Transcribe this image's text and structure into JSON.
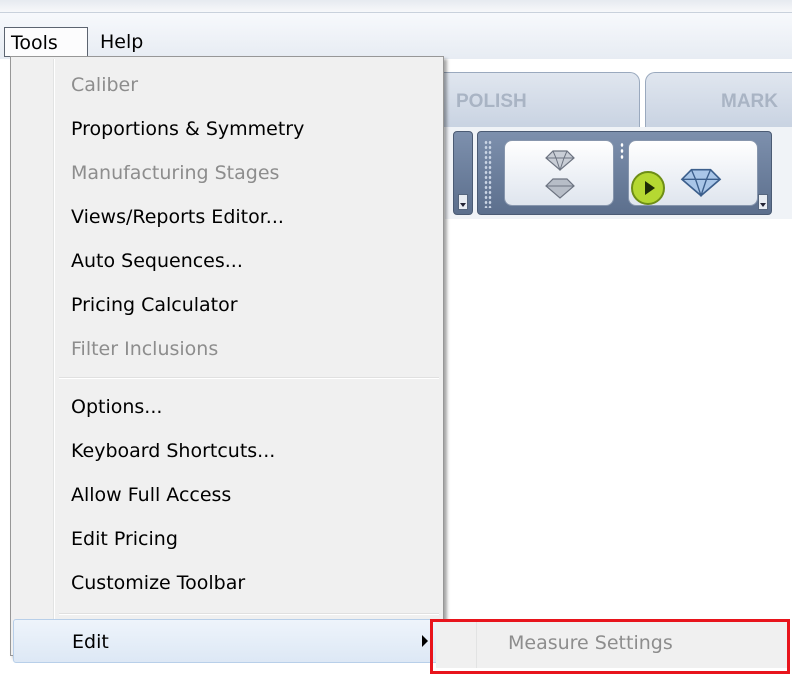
{
  "menubar": {
    "items": [
      "Tools",
      "Help"
    ]
  },
  "app": {
    "tabs": [
      "POLISH",
      "MARK"
    ]
  },
  "tools_menu": {
    "items": [
      {
        "label": "Caliber",
        "enabled": false
      },
      {
        "label": "Proportions & Symmetry",
        "enabled": true
      },
      {
        "label": "Manufacturing Stages",
        "enabled": false
      },
      {
        "label": "Views/Reports Editor...",
        "enabled": true
      },
      {
        "label": "Auto Sequences...",
        "enabled": true
      },
      {
        "label": "Pricing Calculator",
        "enabled": true
      },
      {
        "label": "Filter Inclusions",
        "enabled": false
      },
      {
        "label": "Options...",
        "enabled": true
      },
      {
        "label": "Keyboard Shortcuts...",
        "enabled": true
      },
      {
        "label": "Allow Full Access",
        "enabled": true
      },
      {
        "label": "Edit Pricing",
        "enabled": true
      },
      {
        "label": "Customize Toolbar",
        "enabled": true
      },
      {
        "label": "Edit",
        "enabled": true,
        "submenu": true,
        "highlighted": true
      }
    ]
  },
  "edit_submenu": {
    "items": [
      {
        "label": "Measure Settings",
        "enabled": false
      }
    ]
  },
  "colors": {
    "annotation_box": "#e8141c",
    "disabled_text": "#8d8d8d"
  }
}
